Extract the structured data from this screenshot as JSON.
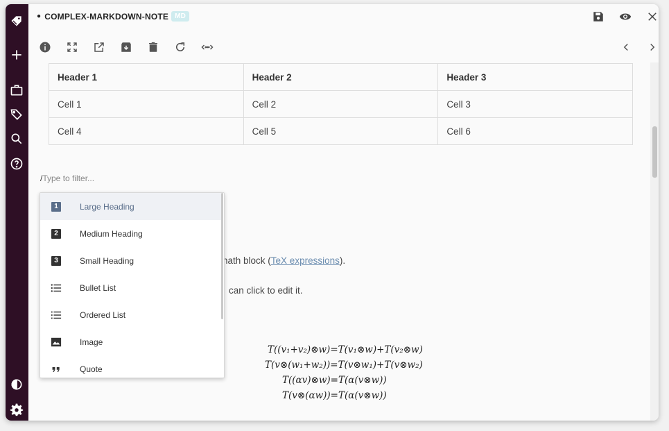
{
  "window": {
    "title": "COMPLEX-MARKDOWN-NOTE",
    "title_dot": "●",
    "badge": "MD"
  },
  "rail": {
    "icons": [
      "tag-icon",
      "plus-icon",
      "briefcase-icon",
      "tags-icon",
      "search-icon",
      "help-icon",
      "contrast-icon",
      "settings-icon"
    ]
  },
  "toolbar": {
    "icons": [
      "info-icon",
      "fullscreen-icon",
      "open-external-icon",
      "archive-icon",
      "trash-icon",
      "refresh-icon",
      "code-icon"
    ],
    "nav_icons": [
      "chevron-left-icon",
      "chevron-right-icon"
    ],
    "header_icons": [
      "save-icon",
      "preview-icon",
      "close-icon"
    ]
  },
  "table": {
    "headers": [
      "Header 1",
      "Header 2",
      "Header 3"
    ],
    "rows": [
      [
        "Cell 1",
        "Cell 2",
        "Cell 3"
      ],
      [
        "Cell 4",
        "Cell 5",
        "Cell 6"
      ]
    ]
  },
  "filter": {
    "caret": "/",
    "placeholder": "Type to filter..."
  },
  "menu": {
    "items": [
      {
        "label": "Large Heading",
        "icon": "heading-1-icon",
        "active": true
      },
      {
        "label": "Medium Heading",
        "icon": "heading-2-icon",
        "active": false
      },
      {
        "label": "Small Heading",
        "icon": "heading-3-icon",
        "active": false
      },
      {
        "label": "Bullet List",
        "icon": "bullet-list-icon",
        "active": false
      },
      {
        "label": "Ordered List",
        "icon": "ordered-list-icon",
        "active": false
      },
      {
        "label": "Image",
        "icon": "image-icon",
        "active": false
      },
      {
        "label": "Quote",
        "icon": "quote-icon",
        "active": false
      }
    ]
  },
  "body_text": {
    "line1_pre": "nath block (",
    "line1_link": "TeX expressions",
    "line1_post": ").",
    "line2": "can click to edit it."
  },
  "math": {
    "lines": [
      "T((v₁+v₂)⊗w)=T(v₁⊗w)+T(v₂⊗w)",
      "T(v⊗(w₁+w₂))=T(v⊗w₁)+T(v⊗w₂)",
      "T((αv)⊗w)=T(α(v⊗w))",
      "T(v⊗(αw))=T(α(v⊗w))"
    ]
  },
  "colors": {
    "rail_bg": "#2e0f25",
    "badge_bg": "#cfecef",
    "menu_active_bg": "#eff1f5",
    "link": "#6a8caf"
  }
}
